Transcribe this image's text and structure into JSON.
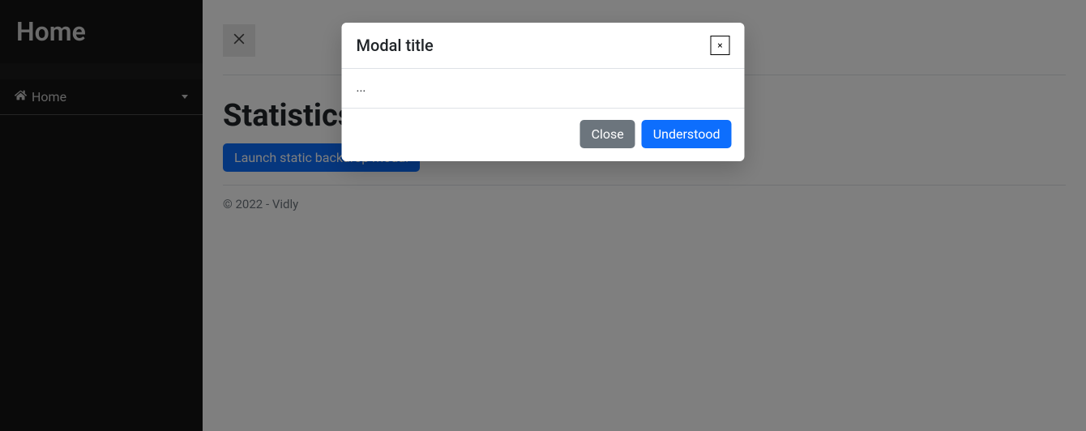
{
  "sidebar": {
    "title": "Home",
    "items": [
      {
        "label": "Home"
      }
    ]
  },
  "page": {
    "heading": "Statistics",
    "launch_button": "Launch static backdrop modal"
  },
  "footer": {
    "text": "© 2022 - Vidly"
  },
  "modal": {
    "title": "Modal title",
    "body": "...",
    "close_label": "Close",
    "confirm_label": "Understood",
    "x_label": "×"
  }
}
